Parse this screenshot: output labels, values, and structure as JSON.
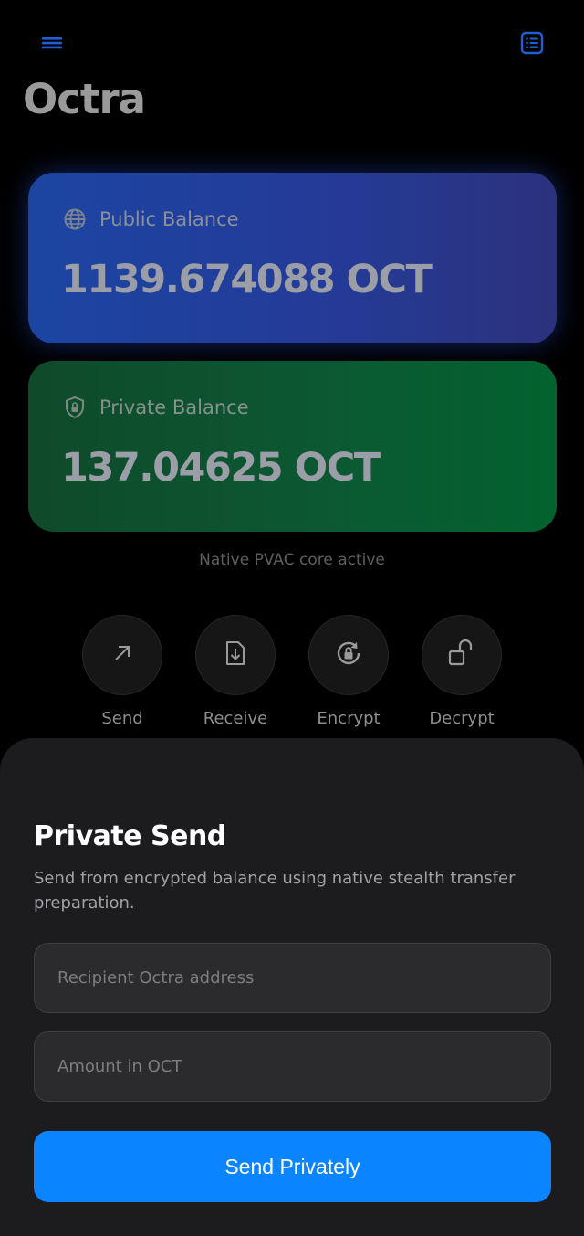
{
  "header": {
    "app_title": "Octra",
    "menu_icon": "hamburger-menu-icon",
    "list_icon": "list-icon",
    "icon_color": "#1e5fd8"
  },
  "public_balance": {
    "label": "Public Balance",
    "amount": "1139.674088 OCT",
    "icon": "globe-icon"
  },
  "private_balance": {
    "label": "Private Balance",
    "amount": "137.04625 OCT",
    "icon": "shield-lock-icon"
  },
  "status": "Native PVAC core active",
  "actions": [
    {
      "label": "Send",
      "icon": "arrow-up-right-icon"
    },
    {
      "label": "Receive",
      "icon": "download-document-icon"
    },
    {
      "label": "Encrypt",
      "icon": "lock-refresh-icon"
    },
    {
      "label": "Decrypt",
      "icon": "unlock-icon"
    }
  ],
  "sheet": {
    "title": "Private Send",
    "description": "Send from encrypted balance using native stealth transfer preparation.",
    "recipient_placeholder": "Recipient Octra address",
    "recipient_value": "",
    "amount_placeholder": "Amount in OCT",
    "amount_value": "",
    "button_label": "Send Privately"
  },
  "colors": {
    "background": "#000000",
    "public_card": "#1c45a2",
    "private_card": "#0c5833",
    "sheet": "#1c1c1e",
    "primary_button": "#0a84ff"
  }
}
